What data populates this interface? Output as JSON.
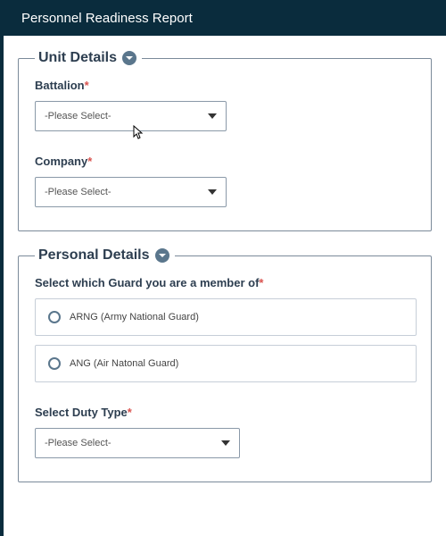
{
  "header": {
    "title": "Personnel Readiness Report"
  },
  "unit": {
    "legend": "Unit Details",
    "battalion": {
      "label": "Battalion",
      "required": "*",
      "value": "-Please Select-"
    },
    "company": {
      "label": "Company",
      "required": "*",
      "value": "-Please Select-"
    }
  },
  "personal": {
    "legend": "Personal Details",
    "guard_question": {
      "label": "Select which Guard you are a member of",
      "required": "*"
    },
    "guard_options": {
      "arng": "ARNG (Army National Guard)",
      "ang": "ANG (Air Natonal Guard)"
    },
    "duty": {
      "label": "Select Duty Type",
      "required": "*",
      "value": "-Please Select-"
    }
  }
}
